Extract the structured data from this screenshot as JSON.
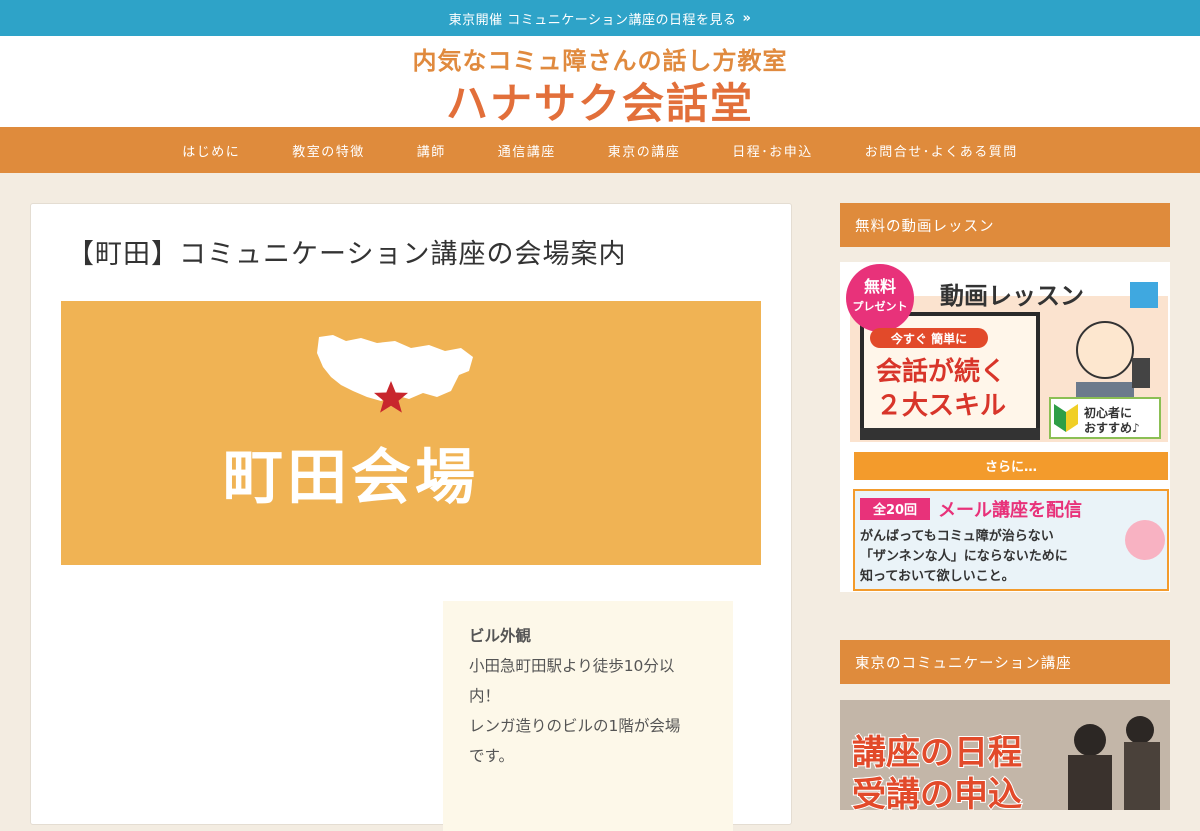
{
  "topbar": {
    "text": "東京開催 コミュニケーション講座の日程を見る",
    "chevron": "»"
  },
  "logo": {
    "subtitle": "内気なコミュ障さんの話し方教室",
    "title": "ハナサク会話堂"
  },
  "nav": {
    "items": [
      "はじめに",
      "教室の特徴",
      "講師",
      "通信講座",
      "東京の講座",
      "日程･お申込",
      "お問合せ･よくある質問"
    ]
  },
  "article": {
    "title": "【町田】コミュニケーション講座の会場案内",
    "hero_text": "町田会場",
    "info": {
      "caption": "ビル外観",
      "lines": [
        "小田急町田駅より徒歩10分以",
        "内！",
        "レンガ造りのビルの1階が会場",
        "です。"
      ]
    }
  },
  "sidebar": {
    "headings": [
      "無料の動画レッスン",
      "東京のコミュニケーション講座"
    ],
    "banner1": {
      "badge_line1": "無料",
      "badge_line2": "プレゼント",
      "title": "動画レッスン",
      "lead": "今すぐ 簡単に",
      "headline1": "会話が続く",
      "headline2": "２大スキル",
      "beginner": "初心者に",
      "beginner2": "おすすめ♪",
      "more": "さらに…",
      "count": "全20回",
      "mail": "メール講座を配信",
      "desc1": "がんばってもコミュ障が治らない",
      "desc2": "「ザンネンな人」にならないために",
      "desc3": "知っておいて欲しいこと。"
    },
    "banner2": {
      "line1": "講座の日程",
      "line2": "受講の申込"
    }
  },
  "colors": {
    "topbar": "#2ea3c8",
    "nav": "#df8b3c",
    "page_bg": "#f3ece1",
    "hero": "#f0b354",
    "logo": "#e26f3a"
  }
}
